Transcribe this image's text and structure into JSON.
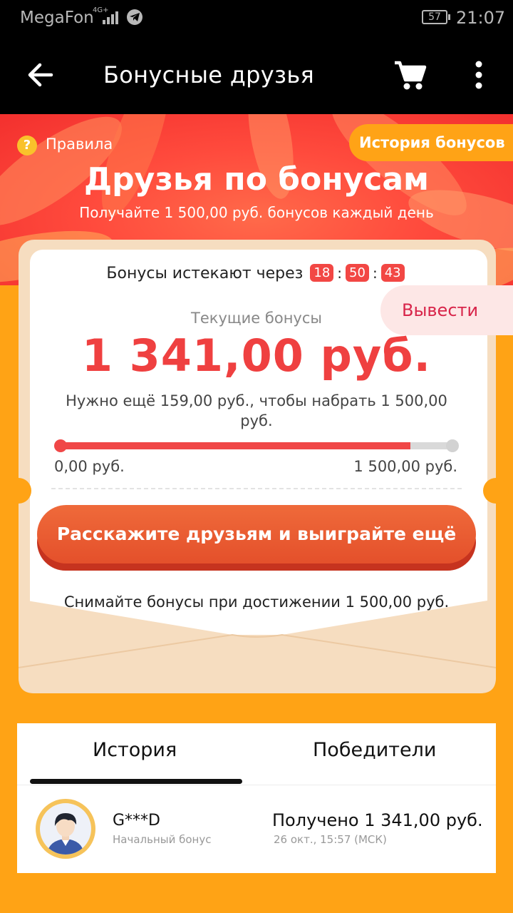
{
  "status_bar": {
    "carrier": "MegaFon",
    "network": "4G+",
    "battery": "57",
    "time": "21:07"
  },
  "toolbar": {
    "title": "Бонусные друзья",
    "back_icon": "back-arrow-icon",
    "cart_icon": "cart-icon",
    "more_icon": "more-vert-icon"
  },
  "hero": {
    "rules_label": "Правила",
    "history_button": "История бонусов",
    "title": "Друзья по бонусам",
    "subtitle": "Получайте 1 500,00 руб. бонусов каждый день"
  },
  "card": {
    "expire_label": "Бонусы истекают через",
    "timer": {
      "hours": "18",
      "minutes": "50",
      "seconds": "43"
    },
    "withdraw_button": "Вывести",
    "current_label": "Текущие бонусы",
    "current_amount": "1 341,00 руб.",
    "need_text": "Нужно ещё 159,00 руб., чтобы набрать 1 500,00 руб.",
    "progress": {
      "value": 1341,
      "max": 1500
    },
    "progress_min_label": "0,00 руб.",
    "progress_max_label": "1 500,00 руб.",
    "share_button": "Расскажите друзьям и выиграйте ещё",
    "withdraw_note": "Снимайте бонусы при достижении 1 500,00 руб."
  },
  "tabs": {
    "items": [
      {
        "label": "История",
        "active": true
      },
      {
        "label": "Победители",
        "active": false
      }
    ],
    "history": [
      {
        "name": "G***D",
        "subtitle": "Начальный бонус",
        "received": "Получено 1 341,00 руб.",
        "time": "26 окт., 15:57 (МСК)"
      }
    ]
  },
  "colors": {
    "accent_red": "#ef4040",
    "orange_bg": "#ffa315",
    "button_orange": "#e4502b",
    "toolbar": "#000000"
  }
}
